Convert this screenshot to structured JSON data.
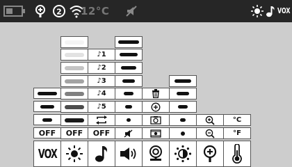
{
  "status_bar": {
    "temperature": "12°C",
    "mode_label": "VOX",
    "icons": [
      "battery-icon",
      "zoom-icon",
      "timer-icon",
      "wifi-icon",
      "mute-icon",
      "brightness-icon",
      "music-note-icon"
    ]
  },
  "off_label": "OFF",
  "vox_label": "VOX",
  "tracks": [
    "♪1",
    "♪2",
    "♪3",
    "♪4",
    "♪5"
  ],
  "temp_units": {
    "celsius": "°C",
    "fahrenheit": "°F"
  },
  "bottom_icons": [
    "vox",
    "brightness-icon",
    "music-note-icon",
    "speaker-icon",
    "camera-icon",
    "light-sensor-icon",
    "zoom-icon",
    "thermometer-icon"
  ],
  "colors": {
    "status_bg": "#262626",
    "panel_bg": "#cdcdcd",
    "cell_bg": "#ffffff",
    "border": "#555555"
  }
}
